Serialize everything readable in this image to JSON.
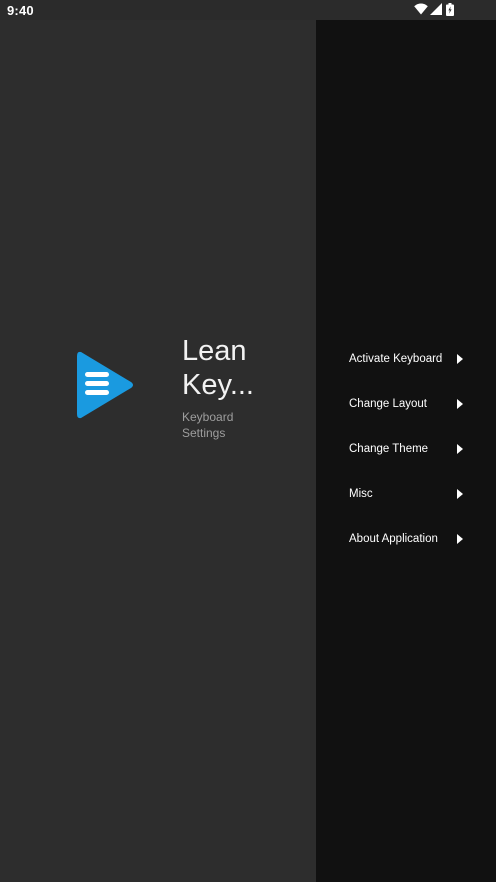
{
  "status_bar": {
    "time": "9:40",
    "icons": [
      "wifi-icon",
      "cellular-signal-icon",
      "battery-icon"
    ]
  },
  "brand": {
    "title_line1": "Lean",
    "title_line2": "Key...",
    "subtitle_line1": "Keyboard",
    "subtitle_line2": "Settings",
    "logo_color": "#1a9ae0"
  },
  "menu": {
    "items": [
      {
        "label": "Activate Keyboard"
      },
      {
        "label": "Change Layout"
      },
      {
        "label": "Change Theme"
      },
      {
        "label": "Misc"
      },
      {
        "label": "About Application"
      }
    ]
  },
  "colors": {
    "left_panel": "#2d2d2d",
    "menu_panel": "#111111",
    "text": "#ffffff",
    "subtitle": "#9e9e9e"
  }
}
